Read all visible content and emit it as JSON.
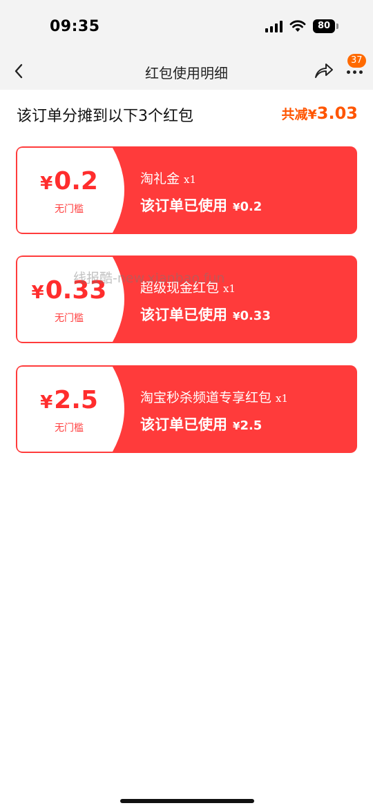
{
  "status_bar": {
    "time": "09:35",
    "battery": "80"
  },
  "nav": {
    "title": "红包使用明细",
    "badge_count": "37"
  },
  "summary": {
    "text": "该订单分摊到以下3个红包",
    "total_label": "共减¥",
    "total_amount": "3.03"
  },
  "packets": [
    {
      "currency": "¥",
      "amount": "0.2",
      "threshold": "无门槛",
      "name": "淘礼金",
      "qty": "x1",
      "used_label": "该订单已使用",
      "used_currency": "¥",
      "used_amount": "0.2"
    },
    {
      "currency": "¥",
      "amount": "0.33",
      "threshold": "无门槛",
      "name": "超级现金红包",
      "qty": "x1",
      "used_label": "该订单已使用",
      "used_currency": "¥",
      "used_amount": "0.33"
    },
    {
      "currency": "¥",
      "amount": "2.5",
      "threshold": "无门槛",
      "name": "淘宝秒杀频道专享红包",
      "qty": "x1",
      "used_label": "该订单已使用",
      "used_currency": "¥",
      "used_amount": "2.5"
    }
  ],
  "watermark": "线报酷-new.xianbao.fun",
  "colors": {
    "card_red": "#ff3b3b",
    "total_orange": "#ff5500",
    "badge_orange": "#ff6a00"
  }
}
